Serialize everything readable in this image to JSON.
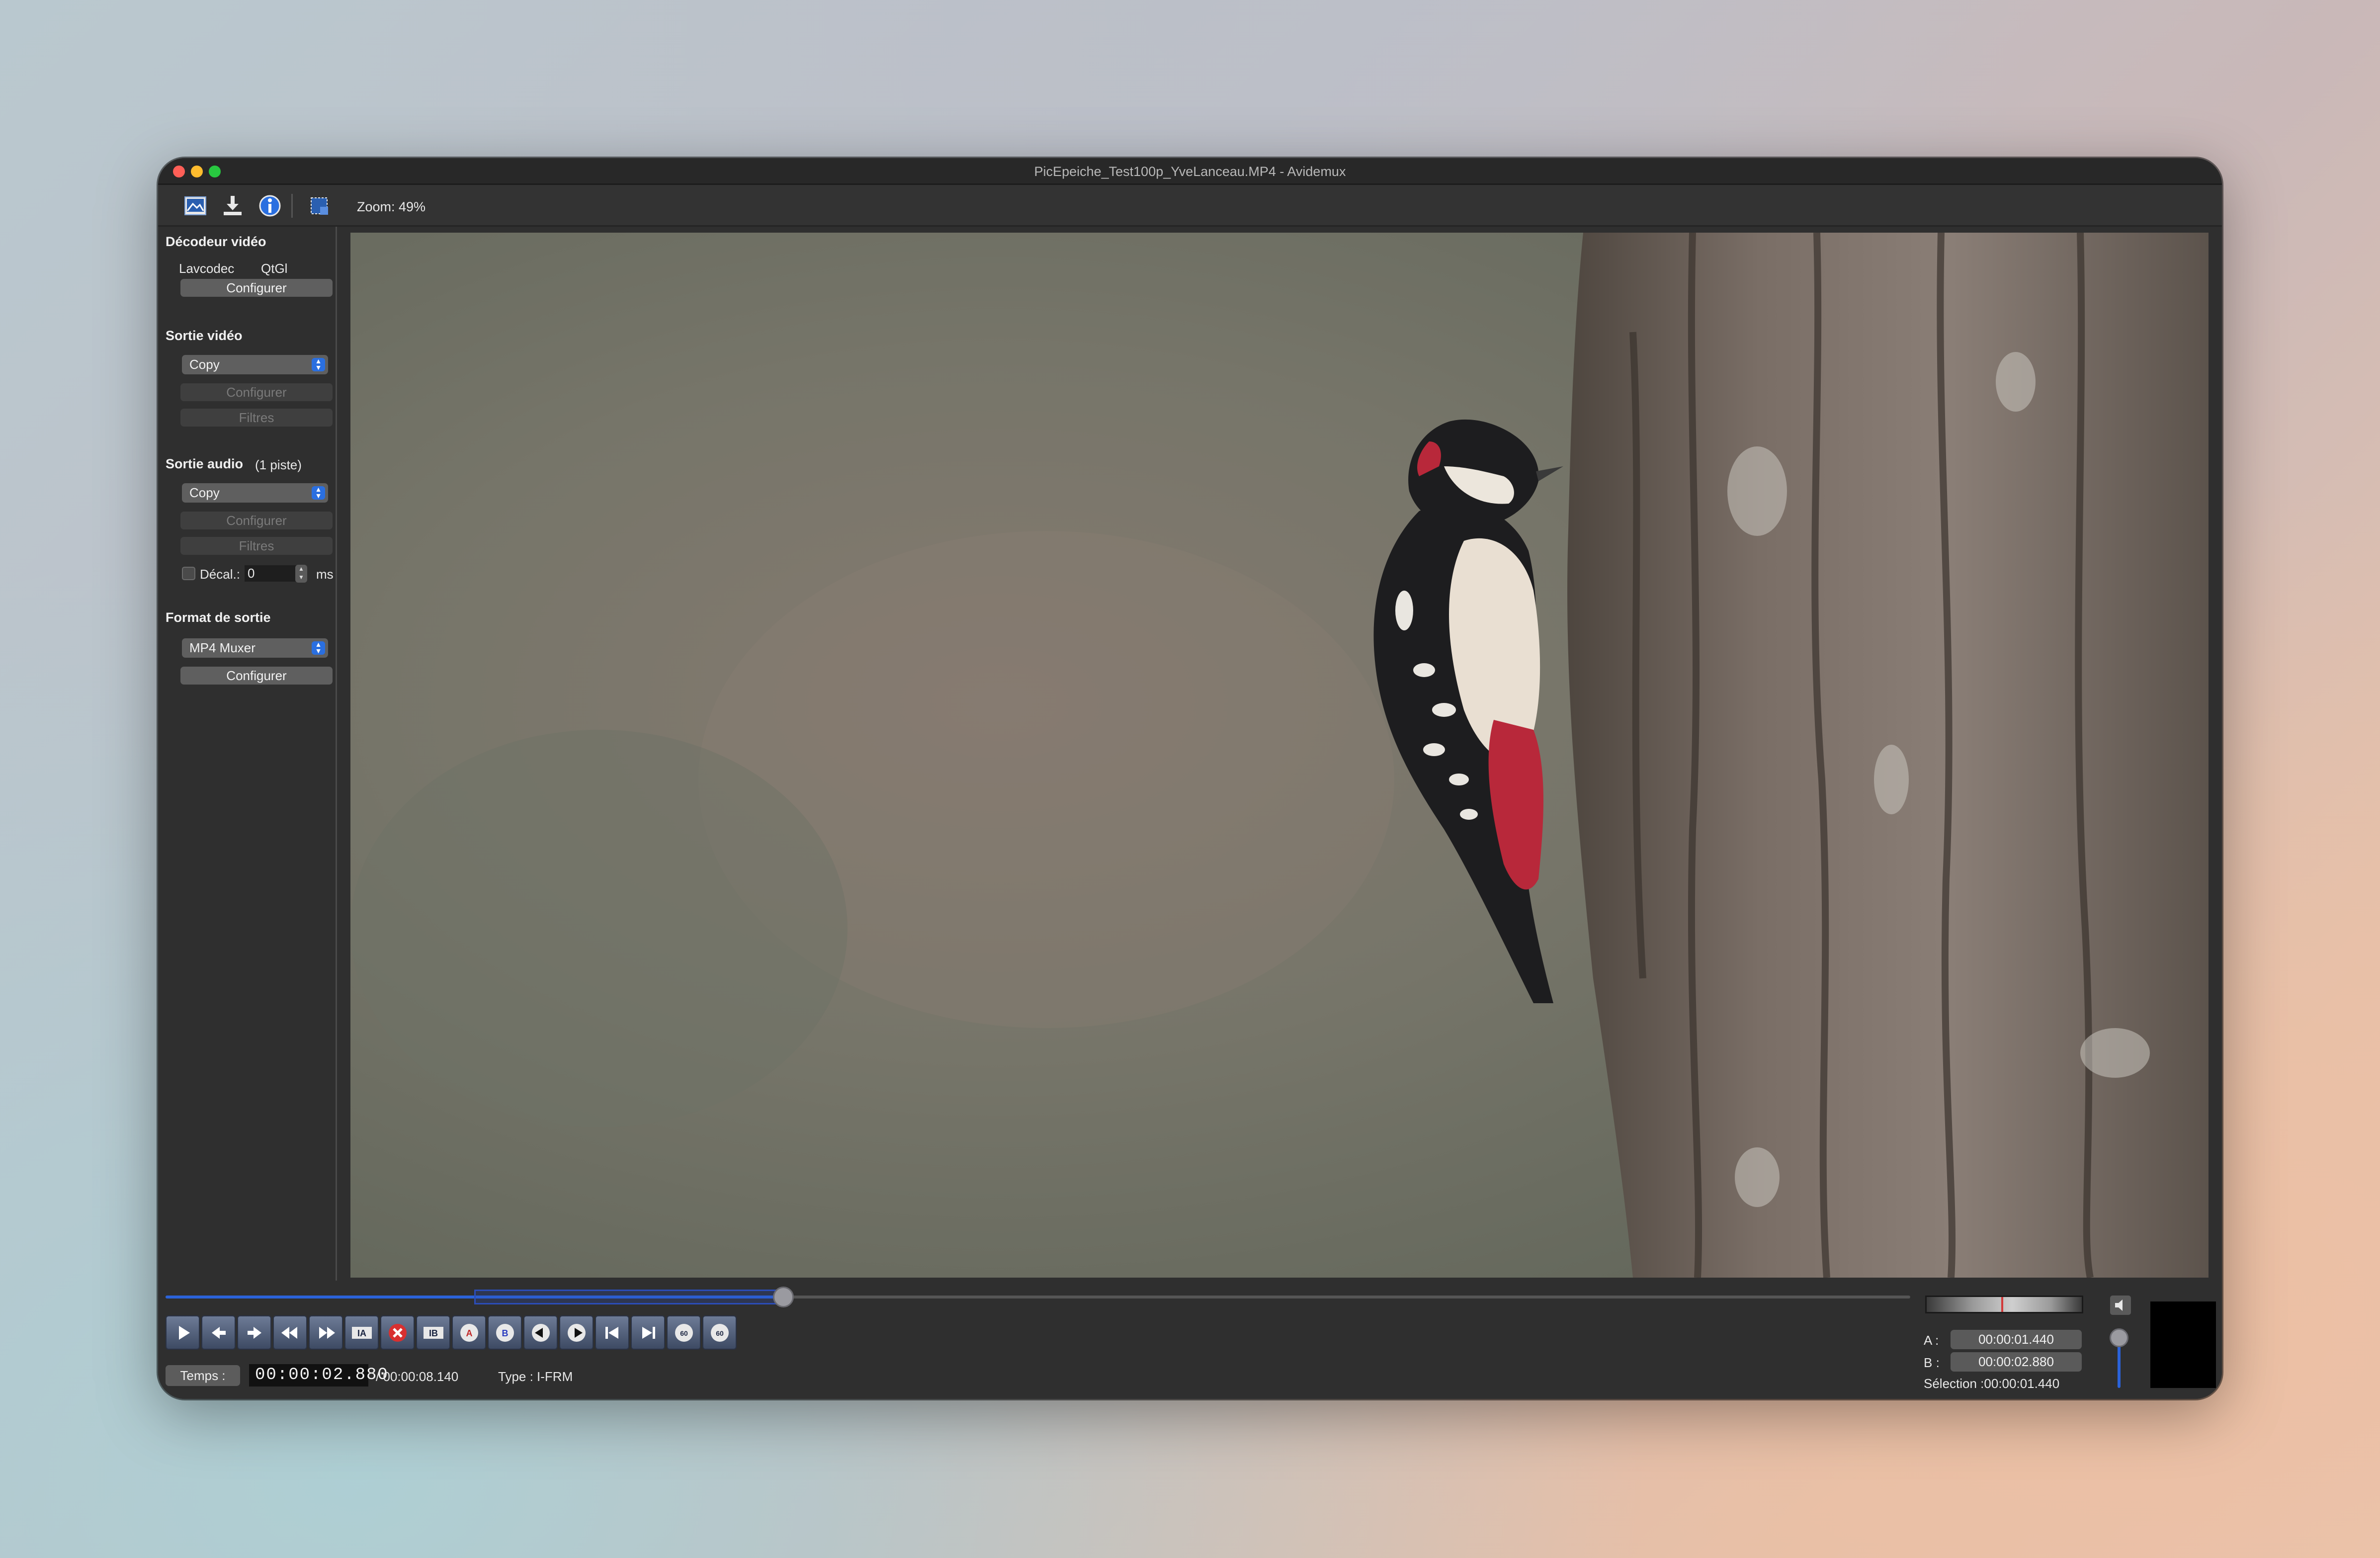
{
  "window": {
    "title": "PicEpeiche_Test100p_YveLanceau.MP4 - Avidemux"
  },
  "toolbar": {
    "zoom": "Zoom: 49%",
    "icons": [
      "open-image-icon",
      "save-download-icon",
      "info-icon",
      "selection-frame-icon"
    ]
  },
  "sidebar": {
    "video_decoder": {
      "heading": "Décodeur vidéo",
      "decoder_name": "Lavcodec",
      "decoder_lib": "QtGl",
      "configure_label": "Configurer"
    },
    "video_output": {
      "heading": "Sortie vidéo",
      "codec": "Copy",
      "configure_label": "Configurer",
      "filters_label": "Filtres"
    },
    "audio_output": {
      "heading": "Sortie audio",
      "track_count": "(1 piste)",
      "codec": "Copy",
      "configure_label": "Configurer",
      "filters_label": "Filtres",
      "shift_label": "Décal.:",
      "shift_value": "0",
      "shift_unit": "ms"
    },
    "output_format": {
      "heading": "Format de sortie",
      "muxer": "MP4 Muxer",
      "configure_label": "Configurer"
    }
  },
  "playback": {
    "position_fraction": 0.354,
    "selection_start_fraction": 0.177,
    "selection_end_fraction": 0.354,
    "controls": [
      "play-icon",
      "prev-frame-icon",
      "next-frame-icon",
      "prev-keyframe-icon",
      "next-keyframe-icon",
      "set-marker-a-icon",
      "delete-selection-icon",
      "set-marker-b-icon",
      "goto-marker-a-icon",
      "goto-marker-b-icon",
      "prev-black-frame-icon",
      "next-black-frame-icon",
      "goto-start-icon",
      "goto-end-icon",
      "back-60s-icon",
      "forward-60s-icon"
    ]
  },
  "status": {
    "time_button_label": "Temps :",
    "current_time": "00:00:02.880",
    "total_time": "/ 00:00:08.140",
    "frame_type": "Type :  I-FRM"
  },
  "markers": {
    "a_label": "A :",
    "a_value": "00:00:01.440",
    "b_label": "B :",
    "b_value": "00:00:02.880",
    "selection": "Sélection :00:00:01.440"
  },
  "volume": {
    "level": 0.6
  },
  "colors": {
    "accent": "#2b63d9",
    "window_bg": "#2f2f2f"
  }
}
